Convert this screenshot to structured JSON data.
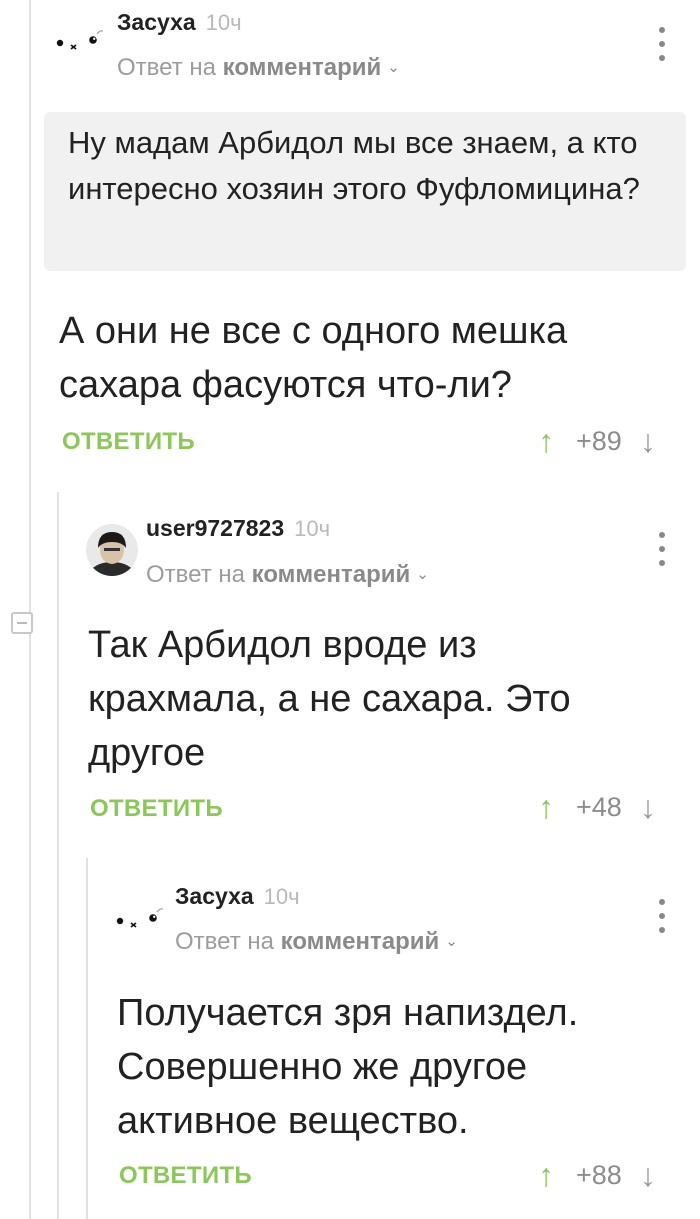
{
  "comments": [
    {
      "username": "Засуха",
      "time": "10ч",
      "reply_prefix": "Ответ на",
      "reply_target": "комментарий",
      "quote": "Ну мадам Арбидол мы все знаем, а кто интересно хозяин этого Фуфломицина?",
      "text": "А они не все с одного мешка сахара фасуются что-ли?",
      "reply_label": "ОТВЕТИТЬ",
      "rating": "+89",
      "avatar_icon": "cat-face-icon"
    },
    {
      "username": "user9727823",
      "time": "10ч",
      "reply_prefix": "Ответ на",
      "reply_target": "комментарий",
      "text": "Так Арбидол вроде из крахмала, а не сахара. Это другое",
      "reply_label": "ОТВЕТИТЬ",
      "rating": "+48",
      "avatar_icon": "user-photo-avatar"
    },
    {
      "username": "Засуха",
      "time": "10ч",
      "reply_prefix": "Ответ на",
      "reply_target": "комментарий",
      "text": "Получается зря напиздел. Совершенно же другое активное вещество.",
      "reply_label": "ОТВЕТИТЬ",
      "rating": "+88",
      "avatar_icon": "cat-face-icon"
    }
  ],
  "icons": {
    "upvote": "↑",
    "downvote": "↓",
    "chevron": "⌄"
  },
  "colors": {
    "accent_green": "#8ac858",
    "quote_bg": "#f1f1f1",
    "muted_text": "#9c9c9c"
  }
}
